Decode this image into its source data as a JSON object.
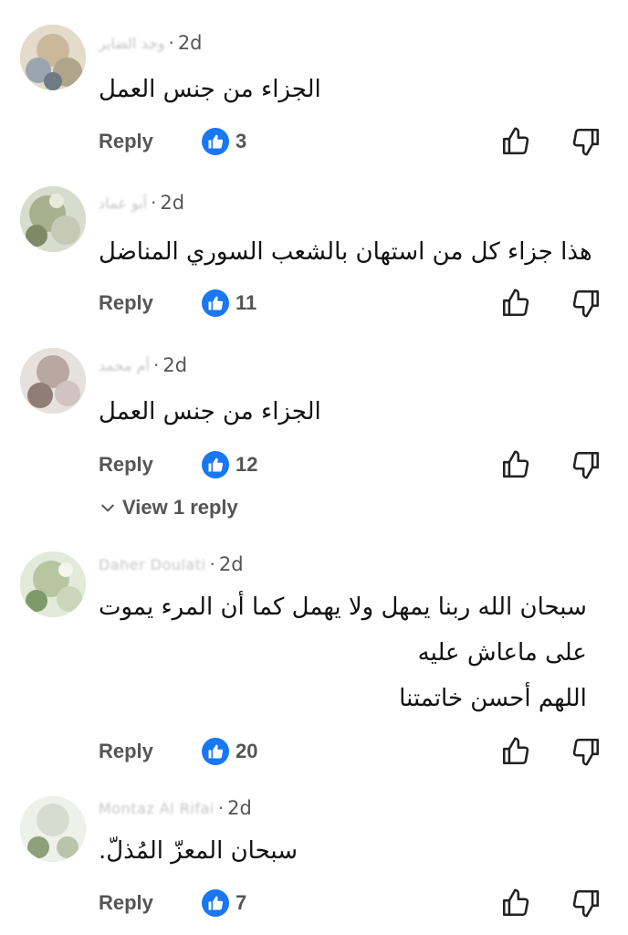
{
  "reply_label": "Reply",
  "colors": {
    "like_badge": "#1877f2",
    "meta_text": "#555555"
  },
  "comments": [
    {
      "author": "وجد الضاير",
      "time": "2d",
      "lines": [
        "الجزاء من جنس العمل"
      ],
      "likes": "3"
    },
    {
      "author": "أبو عماد",
      "time": "2d",
      "lines": [
        "هذا جزاء كل من استهان بالشعب السوري المناضل"
      ],
      "likes": "11"
    },
    {
      "author": "أم محمد",
      "time": "2d",
      "lines": [
        "الجزاء من جنس العمل"
      ],
      "likes": "12",
      "view_replies": "View 1 reply"
    },
    {
      "author": "Daher Doulati",
      "time": "2d",
      "lines": [
        "سبحان الله ربنا يمهل ولا يهمل    كما أن المرء يموت",
        "على ماعاش عليه",
        "اللهم أحسن خاتمتنا"
      ],
      "likes": "20"
    },
    {
      "author": "Montaz Al Rifai",
      "time": "2d",
      "lines": [
        "سبحان المعزّ المُذلّ."
      ],
      "likes": "7"
    }
  ]
}
